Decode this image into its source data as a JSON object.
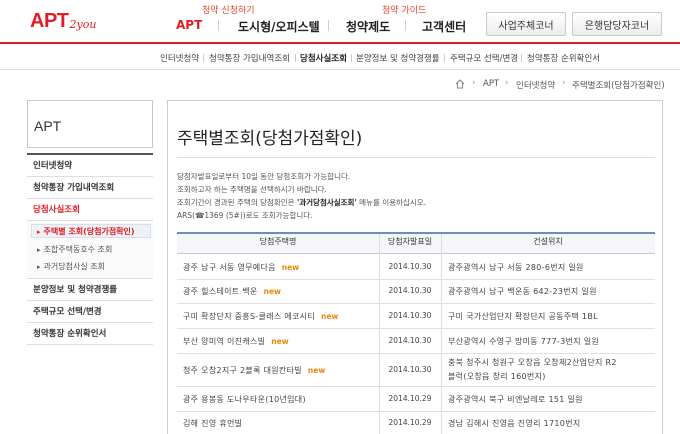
{
  "logo": {
    "main": "APT",
    "sub": "2you"
  },
  "header": {
    "sub_labels": [
      "청약 신청하기",
      "청약 가이드"
    ],
    "gnb": [
      "APT",
      "도시형/오피스텔",
      "청약제도",
      "고객센터"
    ],
    "corner_buttons": [
      "사업주체코너",
      "은행담당자코너"
    ]
  },
  "subnav": {
    "items": [
      "인터넷청약",
      "청약통장 가입내역조회",
      "당첨사실조회",
      "분양정보 및 청약경쟁률",
      "주택규모 선택/변경",
      "청약통장 순위확인서"
    ],
    "current_index": 2
  },
  "breadcrumb": {
    "items": [
      "APT",
      "인터넷청약",
      "주택별조회(당첨가점확인)"
    ]
  },
  "sidebar": {
    "title": "APT",
    "items": [
      "인터넷청약",
      "청약통장 가입내역조회",
      "당첨사실조회",
      "분양정보 및 청약경쟁률",
      "주택규모 선택/변경",
      "청약통장 순위확인서"
    ],
    "sub_items": [
      "주택별 조회(당첨가점확인)",
      "조합주택동호수 조회",
      "과거당첨사실 조회"
    ]
  },
  "main": {
    "title": "주택별조회(당첨가점확인)",
    "desc": [
      "당첨자발표일로부터 10일 동안 당첨조회가 가능합니다.",
      "조회하고자 하는 주택명을 선택하시기 바랍니다.",
      "조회기간이 경과된 주택의 당첨확인은",
      "'과거당첨사실조회'",
      "메뉴를 이용하십시오.",
      "ARS(☎1369 (5#))로도 조회가능합니다."
    ]
  },
  "table": {
    "headers": [
      "당첨주택명",
      "당첨자발표일",
      "건설위치"
    ],
    "new_label": "new",
    "rows": [
      {
        "name": "광주  남구  서동  영무예다음",
        "is_new": true,
        "date": "2014.10.30",
        "loc1": "광주광역시  남구  서동  280-6번지  일원",
        "loc2": ""
      },
      {
        "name": "광주  힐스테이트  백운",
        "is_new": true,
        "date": "2014.10.30",
        "loc1": "광주광역시  남구  백운동  642-23번지  일원",
        "loc2": ""
      },
      {
        "name": "구미  확장단지  중흥S-클래스  에코시티",
        "is_new": true,
        "date": "2014.10.30",
        "loc1": "구미  국가산업단지  확장단지  공동주택  1BL",
        "loc2": ""
      },
      {
        "name": "부산  양미역  이진캐스빌",
        "is_new": true,
        "date": "2014.10.30",
        "loc1": "부산광역시  수영구  망미동  777-3번지  일원",
        "loc2": ""
      },
      {
        "name": "청주  오창2지구  2블록  대원칸타빌",
        "is_new": true,
        "date": "2014.10.30",
        "loc1": "충북  청주시  청원구  오창읍  오창제2산업단지  R2",
        "loc2": "블럭(오창읍  창리  160번지)"
      },
      {
        "name": "광주  용봉동  도나우타운(10년임대)",
        "is_new": false,
        "date": "2014.10.29",
        "loc1": "광주광역시  북구  비엔날레로  151  일원",
        "loc2": ""
      },
      {
        "name": "김해  진영  휴먼빌",
        "is_new": false,
        "date": "2014.10.29",
        "loc1": "경남  김해시  진영읍  진영리  1710번지",
        "loc2": ""
      }
    ]
  },
  "colors": {
    "accent": "#e01d25",
    "table_top": "#6a8fbd",
    "new": "#e8870f"
  }
}
